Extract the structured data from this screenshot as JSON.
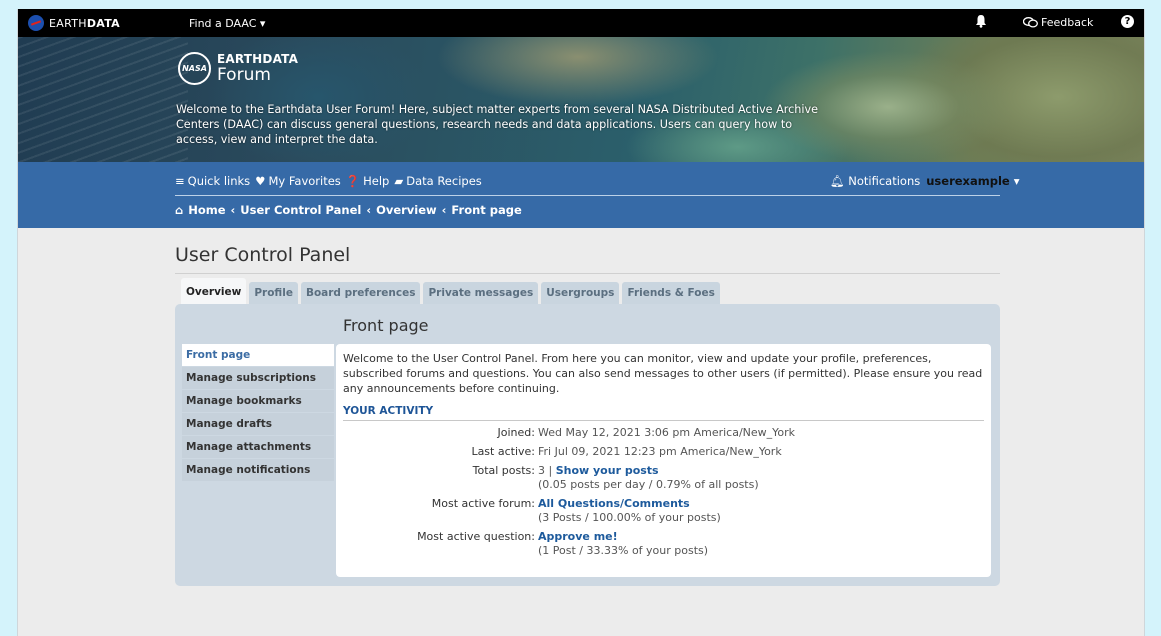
{
  "topbar": {
    "brand_light": "EARTH",
    "brand_bold": "DATA",
    "find_daac": "Find a DAAC",
    "feedback": "Feedback"
  },
  "hero": {
    "logo_line1": "EARTHDATA",
    "logo_line2": "Forum",
    "intro": "Welcome to the Earthdata User Forum! Here, subject matter experts from several NASA Distributed Active Archive Centers (DAAC) can discuss general questions, research needs and data applications. Users can query how to access, view and interpret the data."
  },
  "nav": {
    "quick_links": "Quick links",
    "favorites": "My Favorites",
    "help": "Help",
    "recipes": "Data Recipes",
    "notifications": "Notifications",
    "username": "userexample",
    "crumbs": [
      "Home",
      "User Control Panel",
      "Overview",
      "Front page"
    ]
  },
  "page": {
    "title": "User Control Panel",
    "tabs": [
      "Overview",
      "Profile",
      "Board preferences",
      "Private messages",
      "Usergroups",
      "Friends & Foes"
    ],
    "section_title": "Front page",
    "sidenav": [
      "Front page",
      "Manage subscriptions",
      "Manage bookmarks",
      "Manage drafts",
      "Manage attachments",
      "Manage notifications"
    ],
    "welcome": "Welcome to the User Control Panel. From here you can monitor, view and update your profile, preferences, subscribed forums and questions. You can also send messages to other users (if permitted). Please ensure you read any announcements before continuing.",
    "activity_title": "YOUR ACTIVITY",
    "activity": {
      "joined_label": "Joined:",
      "joined_value": "Wed May 12, 2021 3:06 pm America/New_York",
      "last_active_label": "Last active:",
      "last_active_value": "Fri Jul 09, 2021 12:23 pm America/New_York",
      "total_posts_label": "Total posts:",
      "total_posts_value": "3 |",
      "total_posts_link": "Show your posts",
      "total_posts_sub": "(0.05 posts per day / 0.79% of all posts)",
      "forum_label": "Most active forum:",
      "forum_link": "All Questions/Comments",
      "forum_sub": "(3 Posts / 100.00% of your posts)",
      "question_label": "Most active question:",
      "question_link": "Approve me!",
      "question_sub": "(1 Post / 33.33% of your posts)"
    }
  }
}
